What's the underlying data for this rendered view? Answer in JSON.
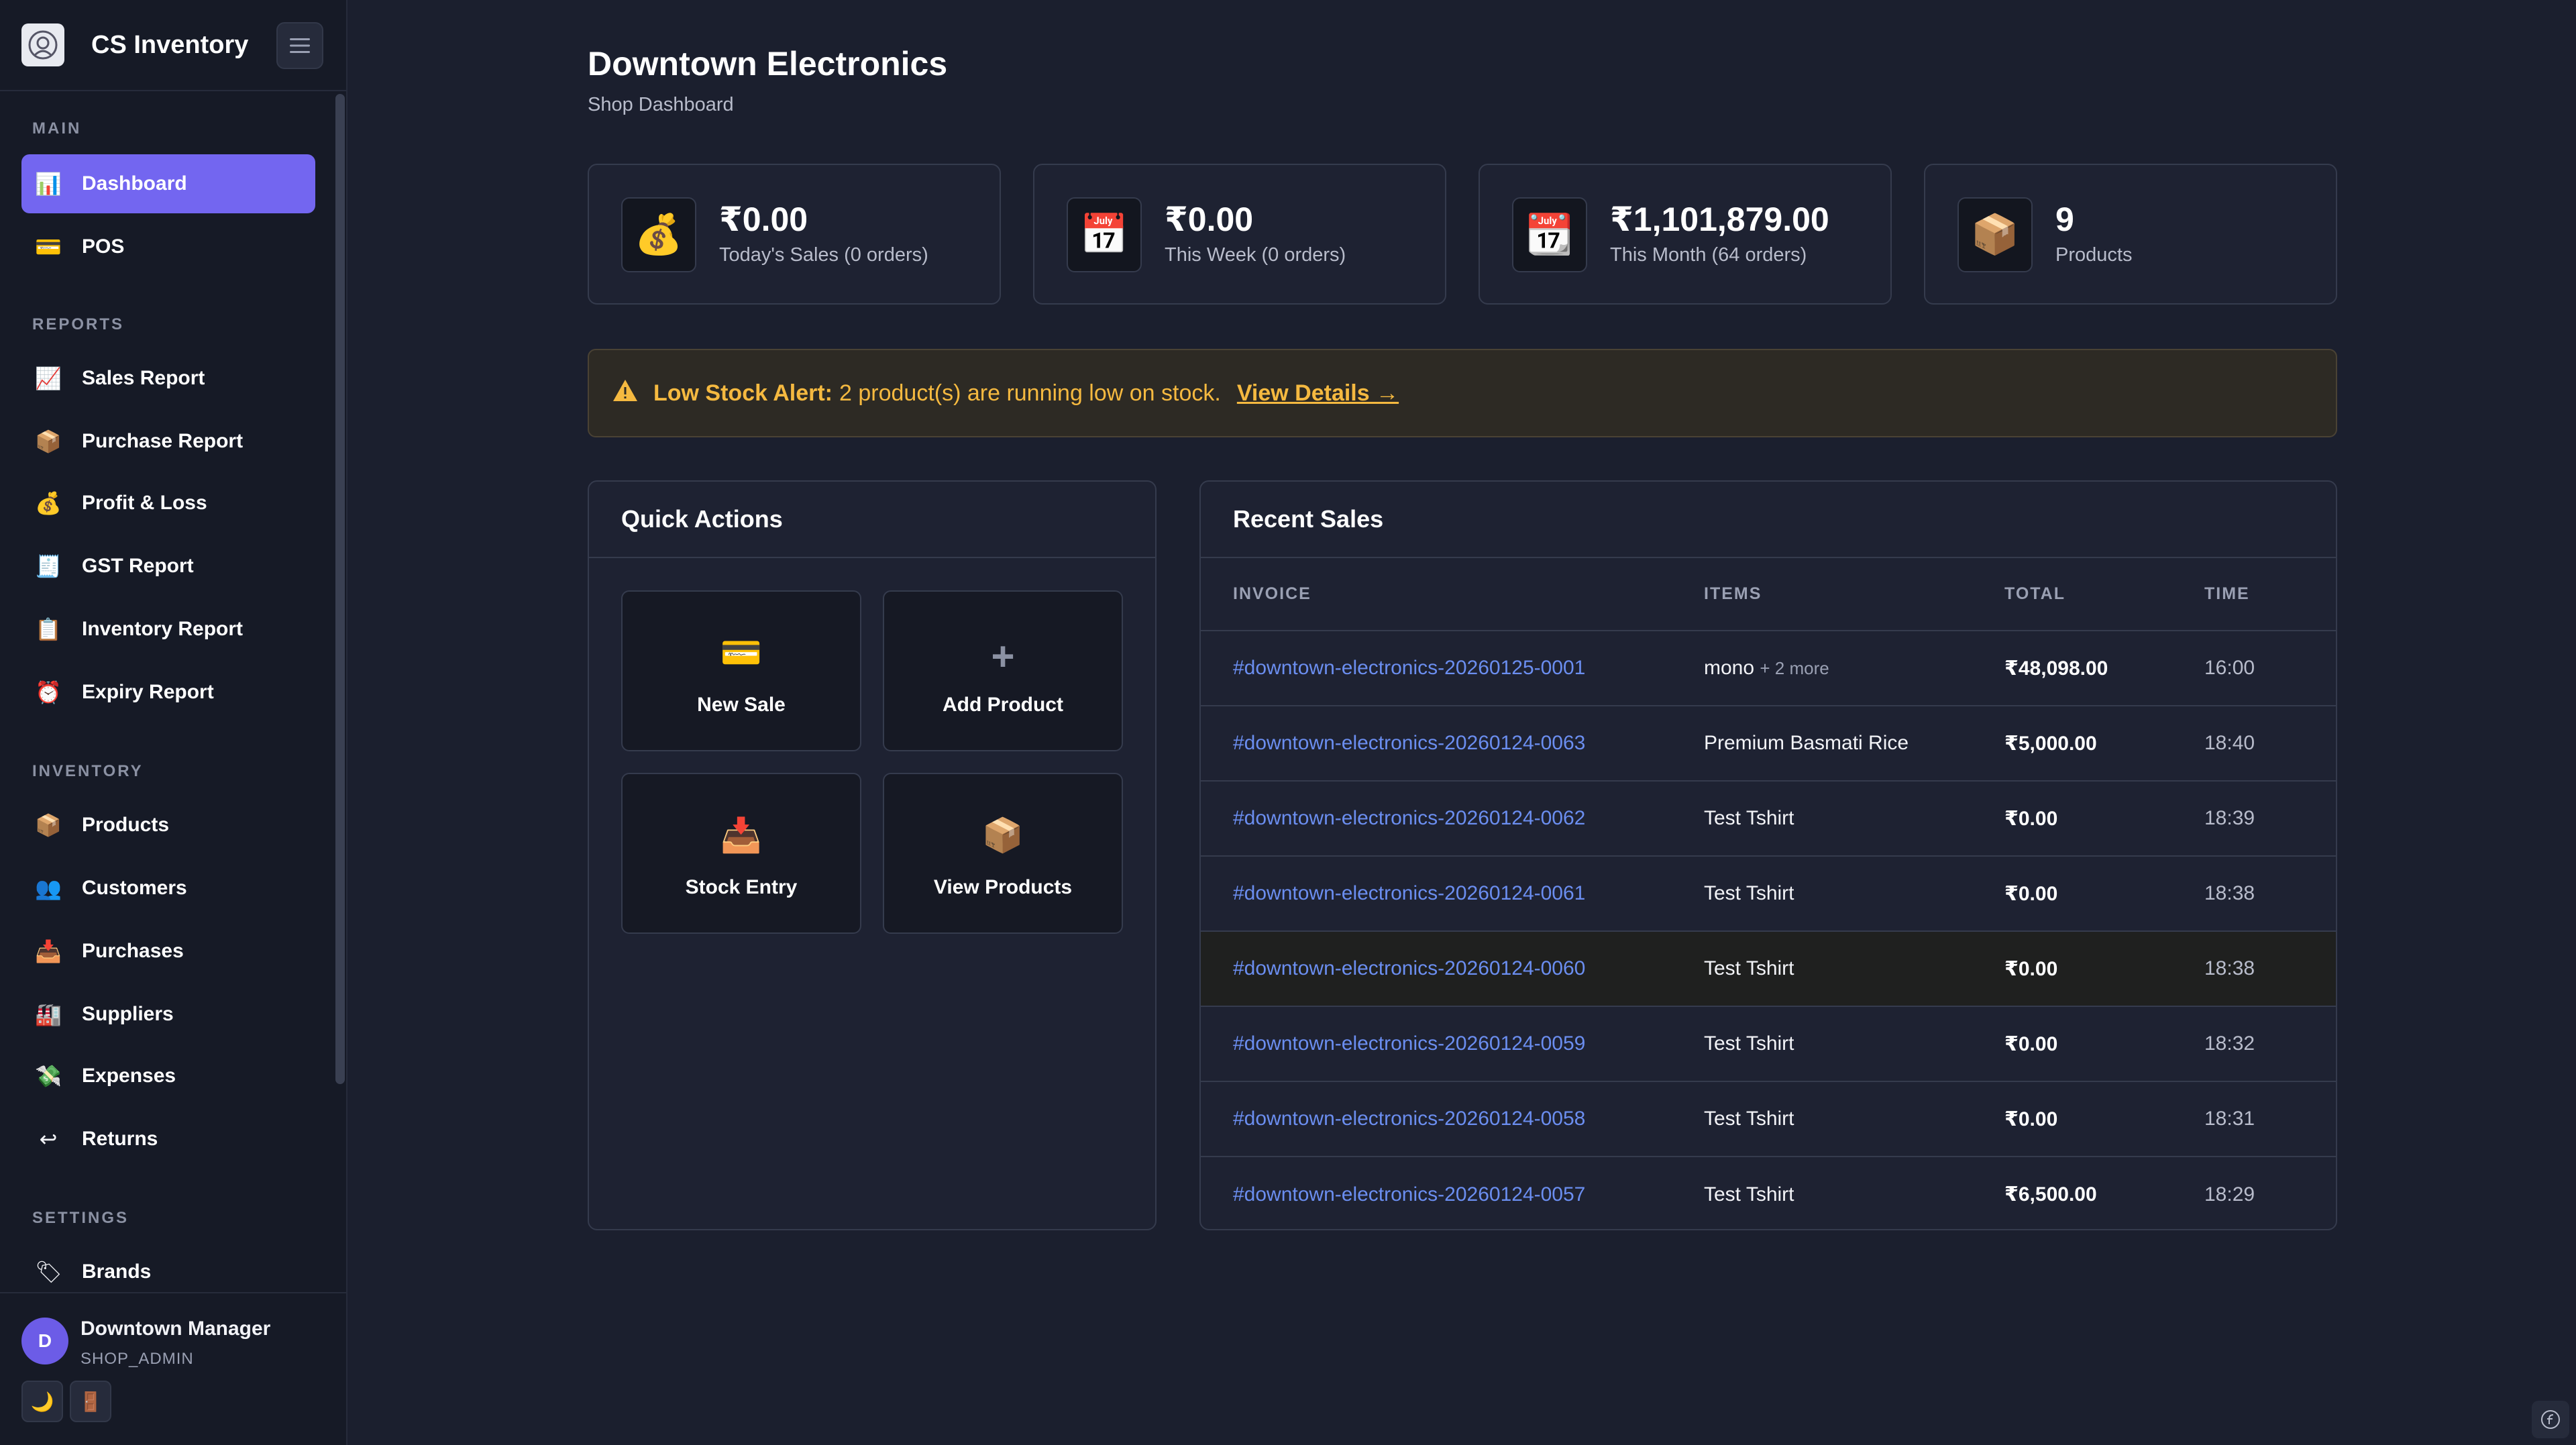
{
  "app": {
    "title": "CS Inventory"
  },
  "sidebar": {
    "sections": [
      {
        "label": "MAIN",
        "items": [
          {
            "label": "Dashboard",
            "icon": "📊",
            "icon_name": "bar-chart-icon",
            "active": true
          },
          {
            "label": "POS",
            "icon": "💳",
            "icon_name": "credit-card-icon"
          }
        ]
      },
      {
        "label": "REPORTS",
        "items": [
          {
            "label": "Sales Report",
            "icon": "📈",
            "icon_name": "trend-chart-icon"
          },
          {
            "label": "Purchase Report",
            "icon": "📦",
            "icon_name": "package-icon"
          },
          {
            "label": "Profit & Loss",
            "icon": "💰",
            "icon_name": "money-bag-icon"
          },
          {
            "label": "GST Report",
            "icon": "🧾",
            "icon_name": "receipt-icon"
          },
          {
            "label": "Inventory Report",
            "icon": "📋",
            "icon_name": "clipboard-icon"
          },
          {
            "label": "Expiry Report",
            "icon": "⏰",
            "icon_name": "alarm-clock-icon"
          }
        ]
      },
      {
        "label": "INVENTORY",
        "items": [
          {
            "label": "Products",
            "icon": "📦",
            "icon_name": "package-icon"
          },
          {
            "label": "Customers",
            "icon": "👥",
            "icon_name": "users-icon"
          },
          {
            "label": "Purchases",
            "icon": "📥",
            "icon_name": "inbox-tray-icon"
          },
          {
            "label": "Suppliers",
            "icon": "🏭",
            "icon_name": "factory-icon"
          },
          {
            "label": "Expenses",
            "icon": "💸",
            "icon_name": "money-wings-icon"
          },
          {
            "label": "Returns",
            "icon": "↩",
            "icon_name": "return-arrow-icon"
          }
        ]
      },
      {
        "label": "SETTINGS",
        "items": [
          {
            "label": "Brands",
            "icon": "🏷",
            "icon_name": "tag-icon"
          }
        ]
      }
    ],
    "user": {
      "initial": "D",
      "name": "Downtown Manager",
      "role": "SHOP_ADMIN"
    },
    "theme_icon": "🌙",
    "logout_icon": "🚪"
  },
  "page": {
    "title": "Downtown Electronics",
    "subtitle": "Shop Dashboard"
  },
  "stats": [
    {
      "icon": "💰",
      "icon_name": "money-bag-icon",
      "value": "₹0.00",
      "label": "Today's Sales (0 orders)"
    },
    {
      "icon": "📅",
      "icon_name": "calendar-icon",
      "value": "₹0.00",
      "label": "This Week (0 orders)"
    },
    {
      "icon": "📆",
      "icon_name": "tear-off-calendar-icon",
      "value": "₹1,101,879.00",
      "label": "This Month (64 orders)"
    },
    {
      "icon": "📦",
      "icon_name": "package-icon",
      "value": "9",
      "label": "Products"
    }
  ],
  "alert": {
    "icon": "⚠",
    "title": "Low Stock Alert:",
    "message": "2 product(s) are running low on stock.",
    "link": "View Details →"
  },
  "quick_actions": {
    "title": "Quick Actions",
    "items": [
      {
        "label": "New Sale",
        "icon": "💳",
        "icon_name": "credit-card-icon"
      },
      {
        "label": "Add Product",
        "icon": "+",
        "icon_name": "plus-icon"
      },
      {
        "label": "Stock Entry",
        "icon": "📥",
        "icon_name": "inbox-tray-icon"
      },
      {
        "label": "View Products",
        "icon": "📦",
        "icon_name": "package-icon"
      }
    ]
  },
  "recent_sales": {
    "title": "Recent Sales",
    "columns": [
      "INVOICE",
      "ITEMS",
      "TOTAL",
      "TIME"
    ],
    "rows": [
      {
        "invoice": "#downtown-electronics-20260125-0001",
        "items": "mono",
        "more": "+ 2 more",
        "total": "₹48,098.00",
        "time": "16:00"
      },
      {
        "invoice": "#downtown-electronics-20260124-0063",
        "items": "Premium Basmati Rice",
        "more": "",
        "total": "₹5,000.00",
        "time": "18:40"
      },
      {
        "invoice": "#downtown-electronics-20260124-0062",
        "items": "Test Tshirt",
        "more": "",
        "total": "₹0.00",
        "time": "18:39"
      },
      {
        "invoice": "#downtown-electronics-20260124-0061",
        "items": "Test Tshirt",
        "more": "",
        "total": "₹0.00",
        "time": "18:38"
      },
      {
        "invoice": "#downtown-electronics-20260124-0060",
        "items": "Test Tshirt",
        "more": "",
        "total": "₹0.00",
        "time": "18:38",
        "highlighted": true
      },
      {
        "invoice": "#downtown-electronics-20260124-0059",
        "items": "Test Tshirt",
        "more": "",
        "total": "₹0.00",
        "time": "18:32"
      },
      {
        "invoice": "#downtown-electronics-20260124-0058",
        "items": "Test Tshirt",
        "more": "",
        "total": "₹0.00",
        "time": "18:31"
      },
      {
        "invoice": "#downtown-electronics-20260124-0057",
        "items": "Test Tshirt",
        "more": "",
        "total": "₹6,500.00",
        "time": "18:29"
      }
    ]
  },
  "colors": {
    "accent": "#7366f0",
    "warning": "#f5b940",
    "link": "#6b8ef0",
    "background": "#1b1f2e"
  }
}
